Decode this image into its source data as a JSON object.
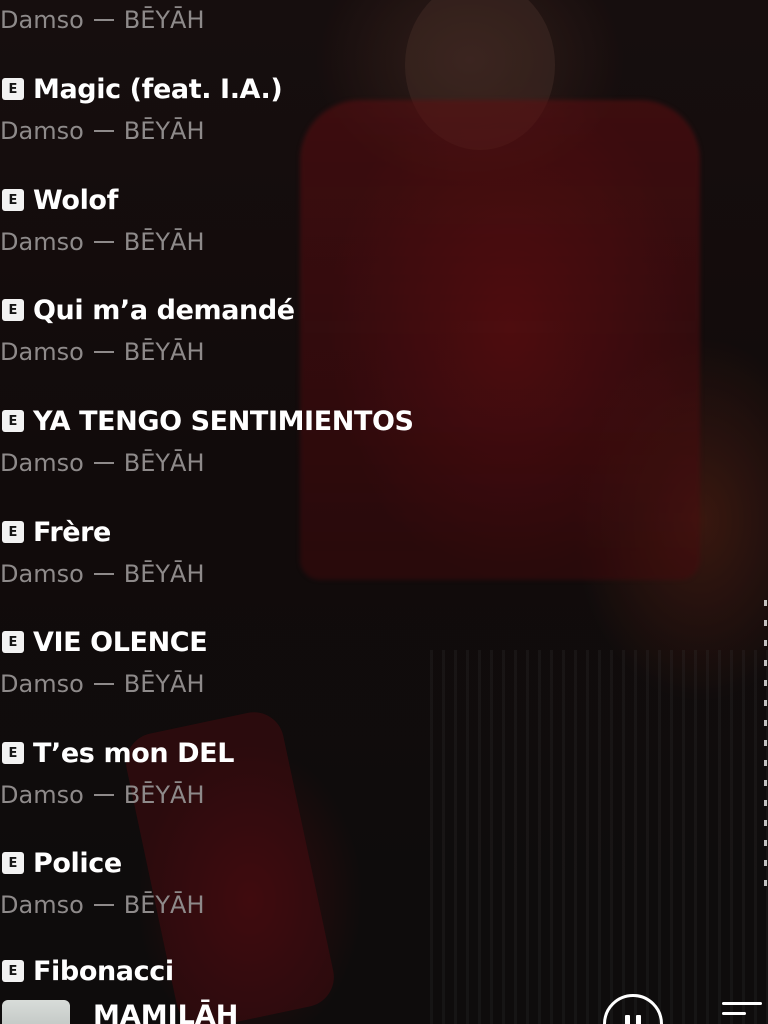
{
  "tracks": [
    {
      "title": "Magic (feat. I.A.)",
      "artist": "Damso",
      "album": "BĒYĀH",
      "explicit_label": "E"
    },
    {
      "title": "Wolof",
      "artist": "Damso",
      "album": "BĒYĀH",
      "explicit_label": "E"
    },
    {
      "title": "Qui m’a demandé",
      "artist": "Damso",
      "album": "BĒYĀH",
      "explicit_label": "E"
    },
    {
      "title": "YA TENGO SENTIMIENTOS",
      "artist": "Damso",
      "album": "BĒYĀH",
      "explicit_label": "E"
    },
    {
      "title": "Frère",
      "artist": "Damso",
      "album": "BĒYĀH",
      "explicit_label": "E"
    },
    {
      "title": "VIE OLENCE",
      "artist": "Damso",
      "album": "BĒYĀH",
      "explicit_label": "E"
    },
    {
      "title": "T’es mon DEL",
      "artist": "Damso",
      "album": "BĒYĀH",
      "explicit_label": "E"
    },
    {
      "title": "Police",
      "artist": "Damso",
      "album": "BĒYĀH",
      "explicit_label": "E"
    },
    {
      "title": "Fibonacci",
      "artist": "Damso",
      "album": "BĒYĀH",
      "explicit_label": "E"
    }
  ],
  "previous_track": {
    "artist": "Damso",
    "album": "BĒYĀH"
  },
  "now_playing": {
    "title": "MAMILĀH",
    "state": "playing"
  },
  "icons": {
    "explicit": "explicit-badge-icon",
    "pause": "pause-icon",
    "queue": "queue-icon"
  },
  "colors": {
    "text_primary": "#ffffff",
    "text_secondary": "#8e8a8a",
    "badge_bg": "#f2f2f2"
  }
}
